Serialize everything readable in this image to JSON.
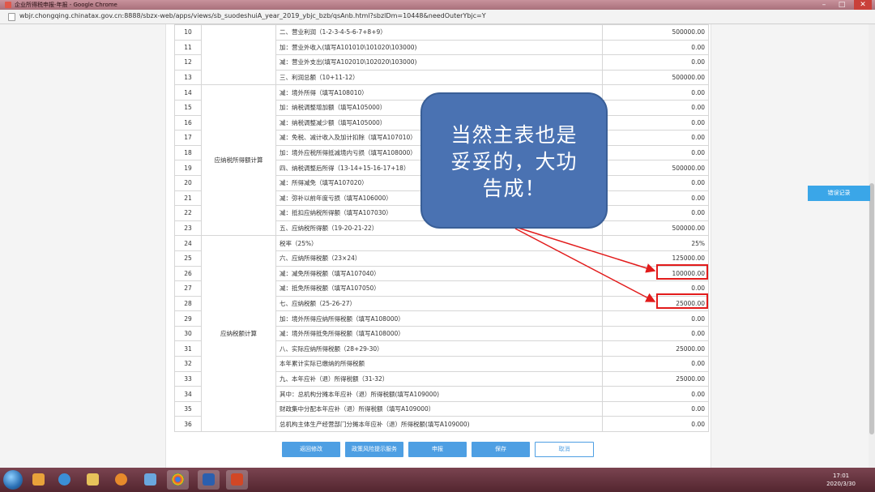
{
  "window": {
    "title": "企业所得税申报-年报 - Google Chrome"
  },
  "address": {
    "url": "wbjr.chongqing.chinatax.gov.cn:8888/sbzx-web/apps/views/sb_suodeshuiA_year_2019_ybjc_bzb/qsAnb.html?sbzlDm=10448&needOuterYbjc=Y"
  },
  "table": {
    "categories": {
      "taxable_income": "应纳税所得额计算",
      "tax_payable": "应纳税额计算"
    },
    "rows": [
      {
        "no": "10",
        "label": "二、营业利润（1-2-3-4-5-6-7+8+9）",
        "value": "500000.00"
      },
      {
        "no": "11",
        "label": "加：营业外收入(填写A101010\\101020\\103000)",
        "value": "0.00"
      },
      {
        "no": "12",
        "label": "减：营业外支出(填写A102010\\102020\\103000)",
        "value": "0.00"
      },
      {
        "no": "13",
        "label": "三、利润总额（10+11-12）",
        "value": "500000.00"
      },
      {
        "no": "14",
        "label": "减：境外所得（填写A108010）",
        "value": "0.00"
      },
      {
        "no": "15",
        "label": "加：纳税调整增加额（填写A105000）",
        "value": "0.00"
      },
      {
        "no": "16",
        "label": "减：纳税调整减少额（填写A105000）",
        "value": "0.00"
      },
      {
        "no": "17",
        "label": "减：免税、减计收入及加计扣除（填写A107010）",
        "value": "0.00"
      },
      {
        "no": "18",
        "label": "加：境外应税所得抵减境内亏损（填写A108000）",
        "value": "0.00"
      },
      {
        "no": "19",
        "label": "四、纳税调整后所得（13-14+15-16-17+18）",
        "value": "500000.00"
      },
      {
        "no": "20",
        "label": "减：所得减免（填写A107020）",
        "value": "0.00"
      },
      {
        "no": "21",
        "label": "减：弥补以前年度亏损（填写A106000）",
        "value": "0.00"
      },
      {
        "no": "22",
        "label": "减：抵扣应纳税所得额（填写A107030）",
        "value": "0.00"
      },
      {
        "no": "23",
        "label": "五、应纳税所得额（19-20-21-22）",
        "value": "500000.00"
      },
      {
        "no": "24",
        "label": "税率（25%）",
        "value": "25%"
      },
      {
        "no": "25",
        "label": "六、应纳所得税额（23×24）",
        "value": "125000.00"
      },
      {
        "no": "26",
        "label": "减：减免所得税额（填写A107040）",
        "value": "100000.00"
      },
      {
        "no": "27",
        "label": "减：抵免所得税额（填写A107050）",
        "value": "0.00"
      },
      {
        "no": "28",
        "label": "七、应纳税额（25-26-27）",
        "value": "25000.00"
      },
      {
        "no": "29",
        "label": "加：境外所得应纳所得税额（填写A108000）",
        "value": "0.00"
      },
      {
        "no": "30",
        "label": "减：境外所得抵免所得税额（填写A108000）",
        "value": "0.00"
      },
      {
        "no": "31",
        "label": "八、实际应纳所得税额（28+29-30）",
        "value": "25000.00"
      },
      {
        "no": "32",
        "label": "本年累计实际已缴纳的所得税额",
        "value": "0.00"
      },
      {
        "no": "33",
        "label": "九、本年应补（退）所得税额（31-32）",
        "value": "25000.00"
      },
      {
        "no": "34",
        "label": "其中：总机构分摊本年应补（退）所得税额(填写A109000)",
        "value": "0.00"
      },
      {
        "no": "35",
        "label": "财政集中分配本年应补（退）所得税额（填写A109000）",
        "value": "0.00"
      },
      {
        "no": "36",
        "label": "总机构主体生产经营部门分摊本年应补（退）所得税额(填写A109000)",
        "value": "0.00"
      }
    ]
  },
  "buttons": {
    "back": "返回修改",
    "risk": "政策风险提示服务",
    "declare": "申报",
    "save": "保存",
    "cancel": "取消"
  },
  "side": {
    "error_record": "错误记录"
  },
  "callout": {
    "line1": "当然主表也是",
    "line2": "妥妥的，大功",
    "line3": "告成！"
  },
  "annotation": {
    "color": "#e21b1b"
  },
  "taskbar": {
    "time": "17:01",
    "date": "2020/3/30",
    "icons": [
      "start-orb",
      "explorer-folder",
      "media-player",
      "chrome",
      "word",
      "powerpoint"
    ]
  }
}
